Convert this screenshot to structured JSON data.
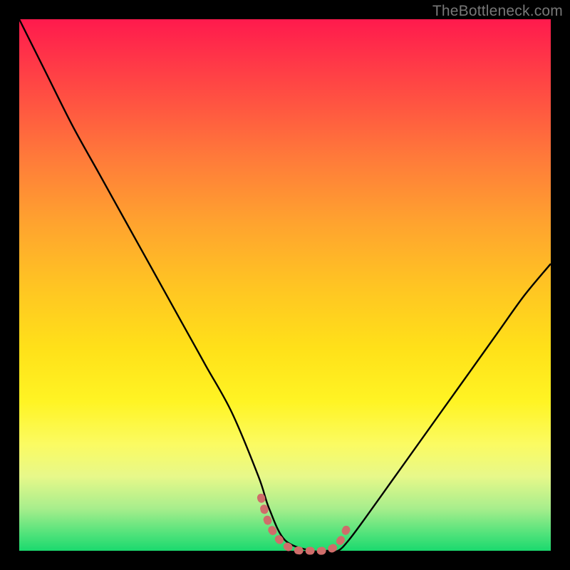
{
  "watermark": "TheBottleneck.com",
  "chart_data": {
    "type": "line",
    "title": "",
    "xlabel": "",
    "ylabel": "",
    "xlim": [
      0,
      100
    ],
    "ylim": [
      0,
      100
    ],
    "series": [
      {
        "name": "curve",
        "color": "#000000",
        "x": [
          0,
          5,
          10,
          15,
          20,
          25,
          30,
          35,
          40,
          45,
          47,
          50,
          55,
          58,
          60,
          62,
          65,
          70,
          75,
          80,
          85,
          90,
          95,
          100
        ],
        "y": [
          100,
          90,
          80,
          71,
          62,
          53,
          44,
          35,
          26,
          14,
          8,
          2,
          0,
          0,
          0,
          2,
          6,
          13,
          20,
          27,
          34,
          41,
          48,
          54
        ]
      },
      {
        "name": "valley-marker",
        "color": "#cf6d6a",
        "x": [
          45.5,
          47,
          49,
          51,
          53,
          55,
          57,
          59,
          60.5,
          62
        ],
        "y": [
          10,
          5,
          2,
          0.5,
          0,
          0,
          0,
          0.5,
          2,
          5
        ]
      }
    ]
  },
  "colors": {
    "background": "#000000",
    "curve": "#000000",
    "marker": "#cf6d6a"
  }
}
